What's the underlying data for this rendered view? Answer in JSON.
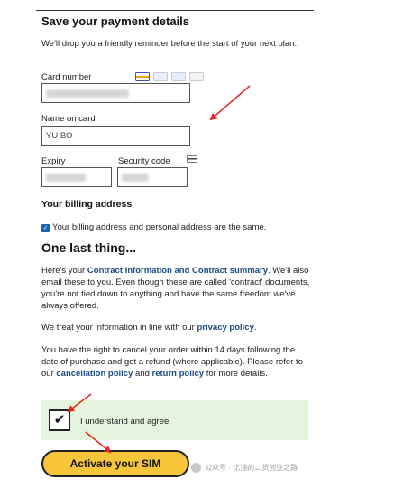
{
  "section_title": "Save your payment details",
  "intro_text": "We'll drop you a friendly reminder before the start of your next plan.",
  "card_number": {
    "label": "Card number",
    "value": ""
  },
  "card_icons": [
    "visa-icon",
    "card-icon",
    "card-icon",
    "card-icon"
  ],
  "name_on_card": {
    "label": "Name on card",
    "value": "YU BO"
  },
  "expiry": {
    "label": "Expiry",
    "value": ""
  },
  "security_code": {
    "label": "Security code",
    "value": ""
  },
  "billing": {
    "title": "Your billing address",
    "checkbox_label": "Your billing address and personal address are the same.",
    "checked": true
  },
  "last_thing": {
    "title": "One last thing...",
    "p1_a": "Here's your ",
    "p1_link1": "Contract Information and Contract summary",
    "p1_b": ". We'll also email these to you. Even though these are called 'contract' documents, you're not tied down to anything and have the same freedom we've always offered.",
    "p2_a": "We treat your information in line with our ",
    "p2_link": "privacy policy",
    "p2_b": ".",
    "p3_a": "You have the right to cancel your order within 14 days following the date of purchase and get a refund (where applicable). Please refer to our ",
    "p3_link1": "cancellation policy",
    "p3_and": " and ",
    "p3_link2": "return policy",
    "p3_b": " for more details."
  },
  "agree": {
    "label": "I understand and agree",
    "checked": true
  },
  "activate_button": "Activate your SIM",
  "watermark": "公众号 · 比油的二货创业之路",
  "colors": {
    "accent_yellow": "#f7c53a",
    "link_blue": "#1a4a86",
    "agree_bg": "#e5f4dd",
    "arrow_red": "#e8231f"
  }
}
